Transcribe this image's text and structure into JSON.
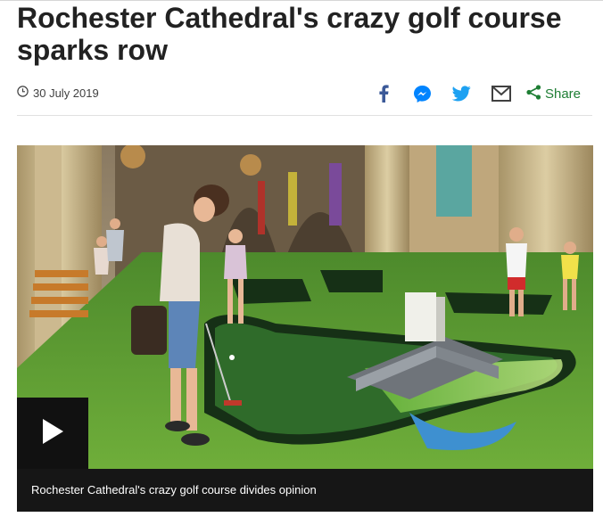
{
  "article": {
    "headline": "Rochester Cathedral's crazy golf course sparks row",
    "date": "30 July 2019"
  },
  "share": {
    "icons": [
      "facebook-icon",
      "messenger-icon",
      "twitter-icon",
      "email-icon"
    ],
    "label": "Share"
  },
  "video": {
    "caption": "Rochester Cathedral's crazy golf course divides opinion",
    "play_icon": "play-icon"
  },
  "colors": {
    "headline": "#222222",
    "brand_blue": "#3b5998",
    "messenger_blue": "#0084ff",
    "twitter_blue": "#1da1f2",
    "share_green": "#1e7e34",
    "caption_bar": "#161616"
  }
}
